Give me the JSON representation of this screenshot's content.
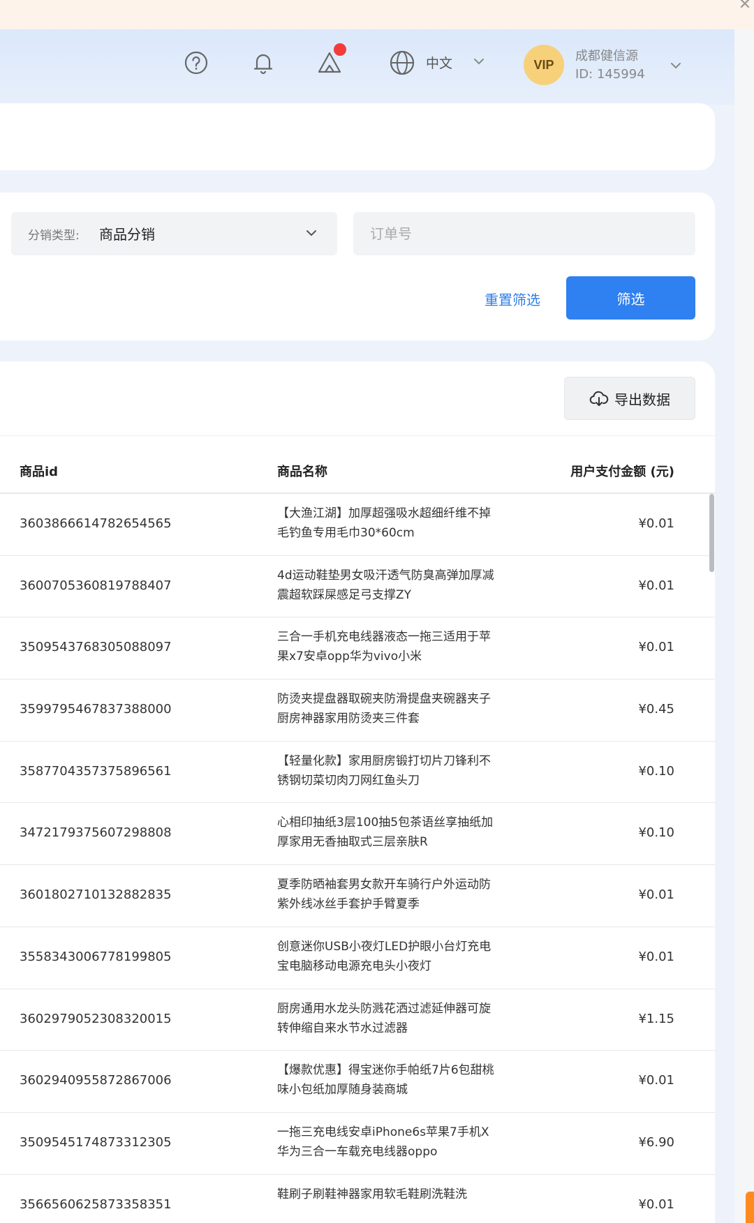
{
  "header": {
    "language": "中文",
    "vip_label": "VIP",
    "user_name": "成都健信源",
    "user_id": "ID: 145994"
  },
  "filter": {
    "type_label": "分销类型:",
    "type_value": "商品分销",
    "order_placeholder": "订单号",
    "reset_label": "重置筛选",
    "filter_label": "筛选"
  },
  "table": {
    "export_label": "导出数据",
    "columns": {
      "id": "商品id",
      "name": "商品名称",
      "amount": "用户支付金额 (元)"
    },
    "rows": [
      {
        "id": "3603866614782654565",
        "name": "【大渔江湖】加厚超强吸水超细纤维不掉毛钓鱼专用毛巾30*60cm",
        "amount": "¥0.01"
      },
      {
        "id": "3600705360819788407",
        "name": "4d运动鞋垫男女吸汗透气防臭高弹加厚减震超软踩屎感足弓支撑ZY",
        "amount": "¥0.01"
      },
      {
        "id": "3509543768305088097",
        "name": "三合一手机充电线器液态一拖三适用于苹果x7安卓opp华为vivo小米",
        "amount": "¥0.01"
      },
      {
        "id": "3599795467837388000",
        "name": "防烫夹提盘器取碗夹防滑提盘夹碗器夹子厨房神器家用防烫夹三件套",
        "amount": "¥0.45"
      },
      {
        "id": "3587704357375896561",
        "name": "【轻量化款】家用厨房锻打切片刀锋利不锈钢切菜切肉刀网红鱼头刀",
        "amount": "¥0.10"
      },
      {
        "id": "3472179375607298808",
        "name": "心相印抽纸3层100抽5包茶语丝享抽纸加厚家用无香抽取式三层亲肤R",
        "amount": "¥0.10"
      },
      {
        "id": "3601802710132882835",
        "name": "夏季防晒袖套男女款开车骑行户外运动防紫外线冰丝手套护手臂夏季",
        "amount": "¥0.01"
      },
      {
        "id": "3558343006778199805",
        "name": "创意迷你USB小夜灯LED护眼小台灯充电宝电脑移动电源充电头小夜灯",
        "amount": "¥0.01"
      },
      {
        "id": "3602979052308320015",
        "name": "厨房通用水龙头防溅花洒过滤延伸器可旋转伸缩自来水节水过滤器",
        "amount": "¥1.15"
      },
      {
        "id": "3602940955872867006",
        "name": "【爆款优惠】得宝迷你手帕纸7片6包甜桃味小包纸加厚随身装商城",
        "amount": "¥0.01"
      },
      {
        "id": "3509545174873312305",
        "name": "一拖三充电线安卓iPhone6s苹果7手机X华为三合一车载充电线器oppo",
        "amount": "¥6.90"
      },
      {
        "id": "3566560625873358351",
        "name": "鞋刷子刷鞋神器家用软毛鞋刷洗鞋洗",
        "amount": "¥0.01"
      }
    ]
  }
}
